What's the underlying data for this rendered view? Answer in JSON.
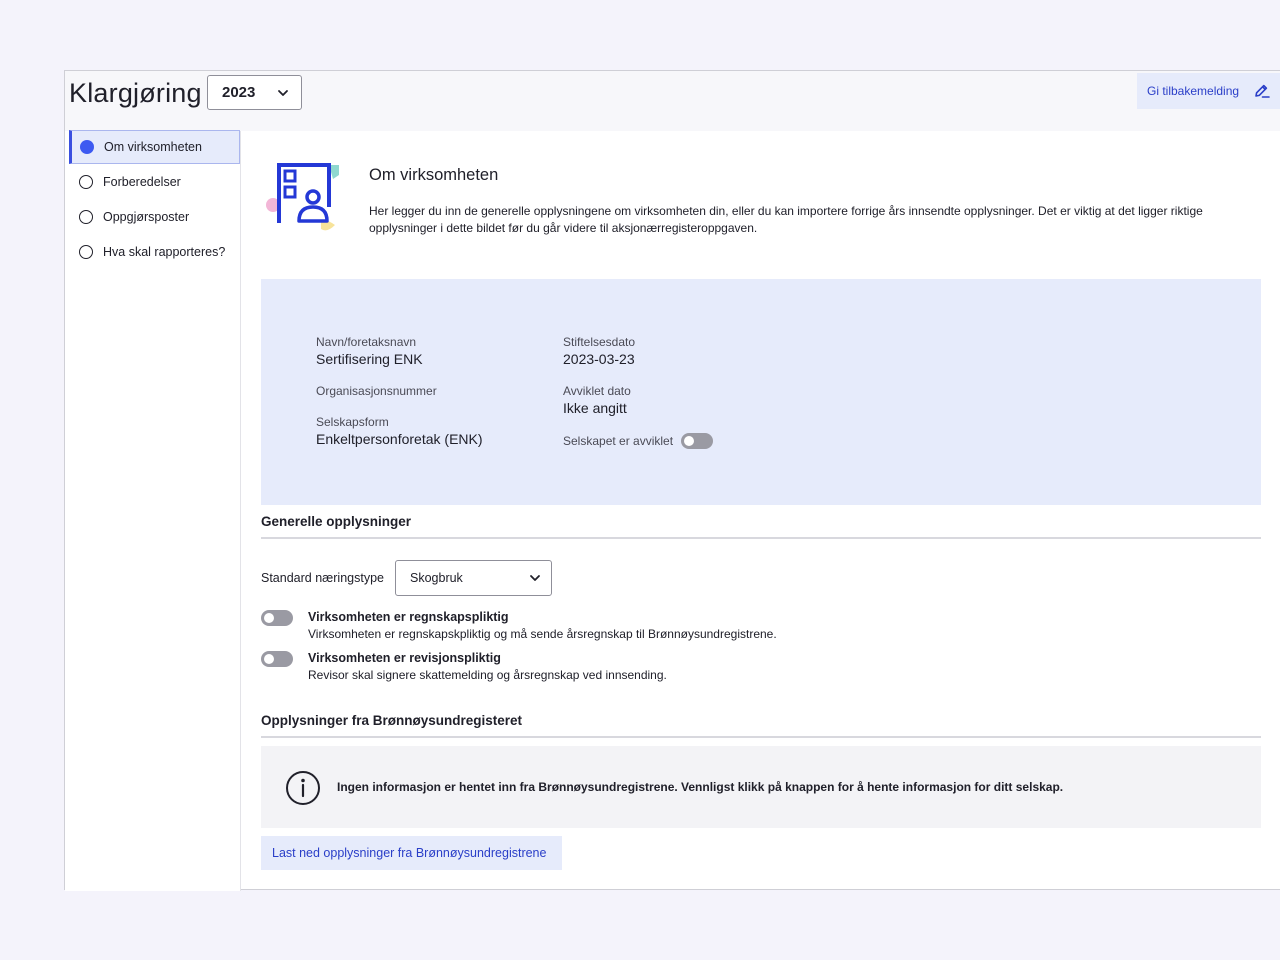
{
  "header": {
    "title": "Klargjøring",
    "year": "2023",
    "feedback_label": "Gi tilbakemelding"
  },
  "sidebar": {
    "items": [
      {
        "label": "Om virksomheten",
        "active": true
      },
      {
        "label": "Forberedelser",
        "active": false
      },
      {
        "label": "Oppgjørsposter",
        "active": false
      },
      {
        "label": "Hva skal rapporteres?",
        "active": false
      }
    ]
  },
  "intro": {
    "title": "Om virksomheten",
    "text": "Her legger du inn de generelle opplysningene om virksomheten din, eller du kan importere forrige års innsendte opplysninger. Det er viktig at det ligger riktige opplysninger i dette bildet før du går videre til aksjonærregisteroppgaven."
  },
  "company": {
    "name_label": "Navn/foretaksnavn",
    "name_value": "Sertifisering ENK",
    "orgnr_label": "Organisasjonsnummer",
    "form_label": "Selskapsform",
    "form_value": "Enkeltpersonforetak (ENK)",
    "founded_label": "Stiftelsesdato",
    "founded_value": "2023-03-23",
    "dissolved_label": "Avviklet dato",
    "dissolved_value": "Ikke angitt",
    "dissolved_toggle_label": "Selskapet er avviklet"
  },
  "general": {
    "title": "Generelle opplysninger",
    "naering_label": "Standard næringstype",
    "naering_value": "Skogbruk",
    "toggles": [
      {
        "title": "Virksomheten er regnskapspliktig",
        "desc": "Virksomheten er regnskapskpliktig og må sende årsregnskap til Brønnøysundregistrene.",
        "on": false
      },
      {
        "title": "Virksomheten er revisjonspliktig",
        "desc": "Revisor skal signere skattemelding og årsregnskap ved innsending.",
        "on": false
      }
    ]
  },
  "brreg": {
    "title": "Opplysninger fra Brønnøysundregisteret",
    "info_text": "Ingen informasjon er hentet inn fra Brønnøysundregistrene. Vennligst klikk på knappen for å hente informasjon for ditt selskap.",
    "download_label": "Last ned opplysninger fra Brønnøysundregistrene"
  },
  "colors": {
    "accent": "#3d5af1",
    "link": "#2a3ec8",
    "panel": "#e6ebfb"
  },
  "icons": {
    "year_chevron": "chevron-down-icon",
    "feedback": "pencil-edit-icon",
    "intro": "building-person-illustration-icon",
    "info": "info-circle-icon"
  }
}
